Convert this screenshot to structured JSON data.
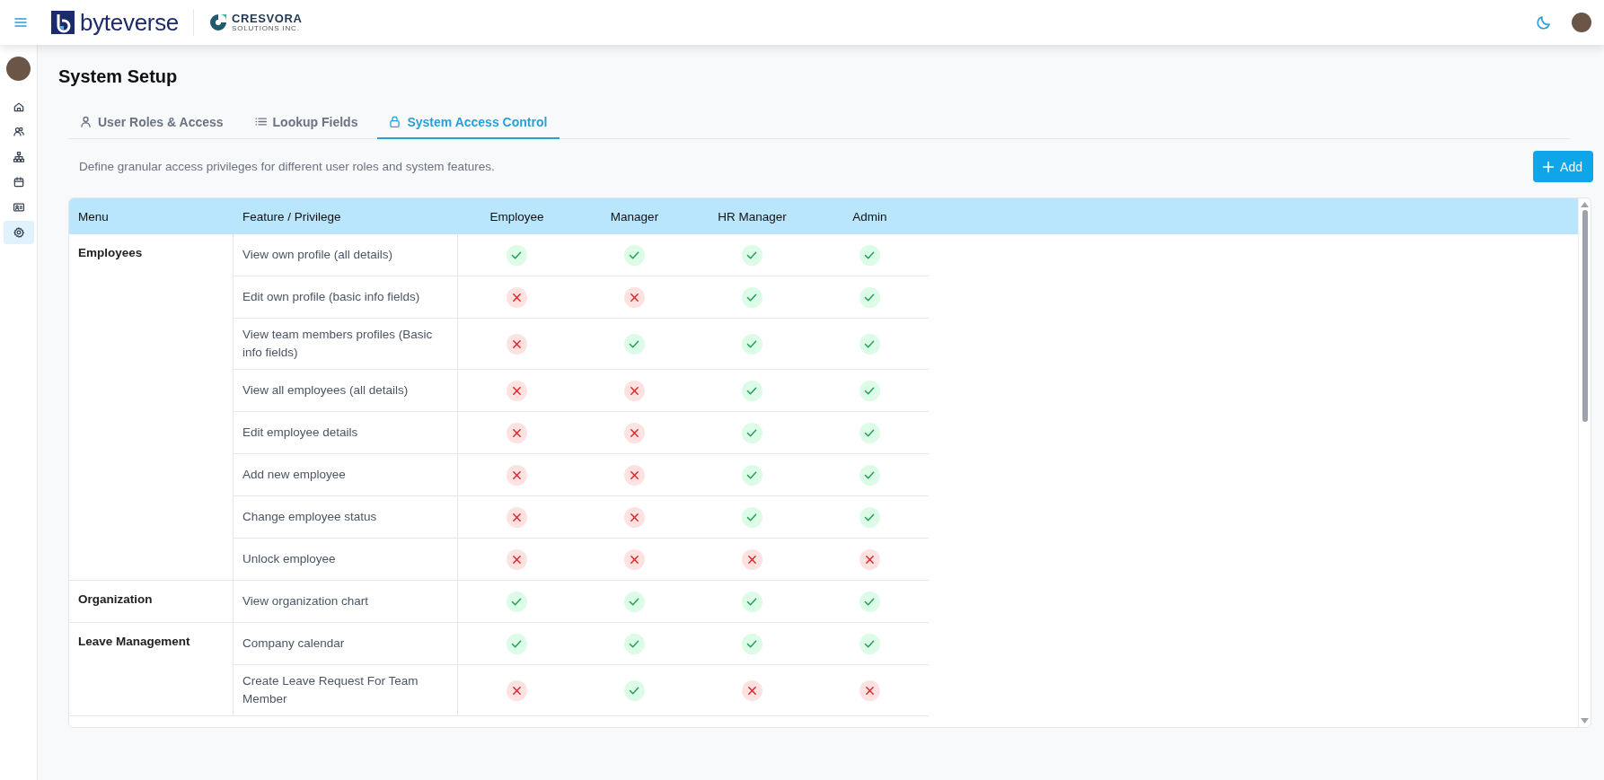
{
  "header": {
    "brand": "byteverse",
    "partner_name": "CRESVORA",
    "partner_tagline": "SOLUTIONS INC."
  },
  "sidebar": {
    "items": [
      {
        "selected": false
      },
      {
        "selected": false
      },
      {
        "selected": false
      },
      {
        "selected": false
      },
      {
        "selected": false
      },
      {
        "selected": true
      }
    ]
  },
  "page": {
    "title": "System Setup",
    "description": "Define granular access privileges for different user roles and system features.",
    "add_button": "Add"
  },
  "tabs": [
    {
      "label": "User Roles & Access",
      "selected": false
    },
    {
      "label": "Lookup Fields",
      "selected": false
    },
    {
      "label": "System Access Control",
      "selected": true
    }
  ],
  "table": {
    "columns": [
      "Menu",
      "Feature / Privilege",
      "Employee",
      "Manager",
      "HR Manager",
      "Admin"
    ],
    "groups": [
      {
        "menu": "Employees",
        "rows": [
          {
            "feature": "View own profile (all details)",
            "access": [
              true,
              true,
              true,
              true
            ]
          },
          {
            "feature": "Edit own profile (basic info fields)",
            "access": [
              false,
              false,
              true,
              true
            ]
          },
          {
            "feature": "View team members profiles (Basic info fields)",
            "access": [
              false,
              true,
              true,
              true
            ]
          },
          {
            "feature": "View all employees (all details)",
            "access": [
              false,
              false,
              true,
              true
            ]
          },
          {
            "feature": "Edit employee details",
            "access": [
              false,
              false,
              true,
              true
            ]
          },
          {
            "feature": "Add new employee",
            "access": [
              false,
              false,
              true,
              true
            ]
          },
          {
            "feature": "Change employee status",
            "access": [
              false,
              false,
              true,
              true
            ]
          },
          {
            "feature": "Unlock employee",
            "access": [
              false,
              false,
              false,
              false
            ]
          }
        ]
      },
      {
        "menu": "Organization",
        "rows": [
          {
            "feature": "View organization chart",
            "access": [
              true,
              true,
              true,
              true
            ]
          }
        ]
      },
      {
        "menu": "Leave Management",
        "rows": [
          {
            "feature": "Company calendar",
            "access": [
              true,
              true,
              true,
              true
            ]
          },
          {
            "feature": "Create Leave Request For Team Member",
            "access": [
              false,
              true,
              false,
              false
            ]
          }
        ]
      }
    ]
  }
}
